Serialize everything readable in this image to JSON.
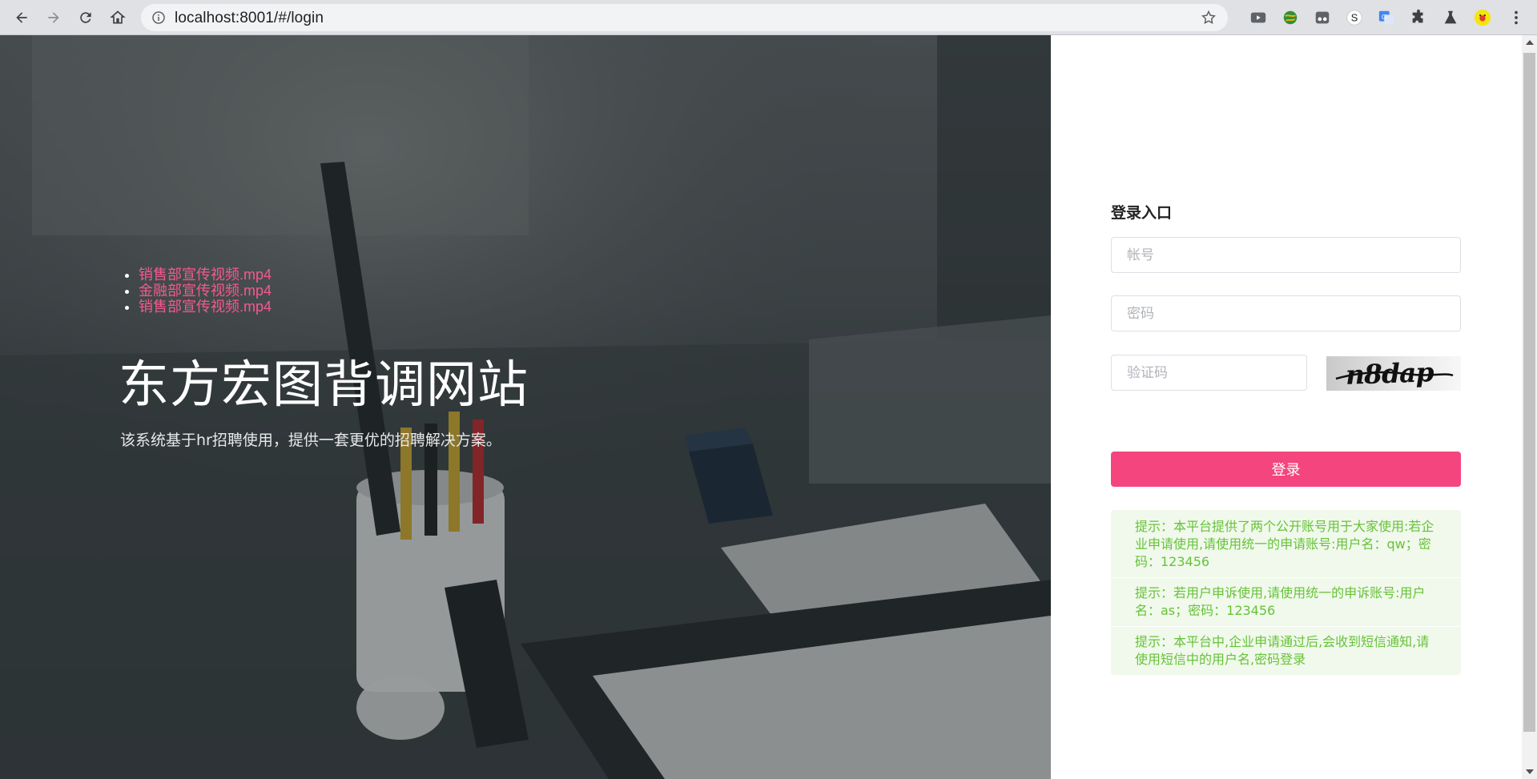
{
  "browser": {
    "url": "localhost:8001/#/login",
    "extensions": [
      "youtube-icon",
      "globe-extension-icon",
      "incognito-extension-icon",
      "s-extension-icon",
      "translate-extension-icon",
      "puzzle-icon",
      "flask-icon",
      "profile-avatar"
    ]
  },
  "hero": {
    "videos": [
      "销售部宣传视频.mp4",
      "金融部宣传视频.mp4",
      "销售部宣传视频.mp4"
    ],
    "title": "东方宏图背调网站",
    "description": "该系统基于hr招聘使用，提供一套更优的招聘解决方案。"
  },
  "login": {
    "title": "登录入口",
    "account_placeholder": "帐号",
    "password_placeholder": "密码",
    "captcha_placeholder": "验证码",
    "captcha_text": "n8dap",
    "submit_label": "登录"
  },
  "tips": [
    "提示：本平台提供了两个公开账号用于大家使用:若企业申请使用,请使用统一的申请账号:用户名：qw；密码：123456",
    "提示：若用户申诉使用,请使用统一的申诉账号:用户名：as；密码：123456",
    "提示：本平台中,企业申请通过后,会收到短信通知,请使用短信中的用户名,密码登录"
  ],
  "colors": {
    "accent": "#f4457f",
    "link": "#f45a8d",
    "tip_text": "#67c23a",
    "tip_bg": "#f0f9eb"
  }
}
